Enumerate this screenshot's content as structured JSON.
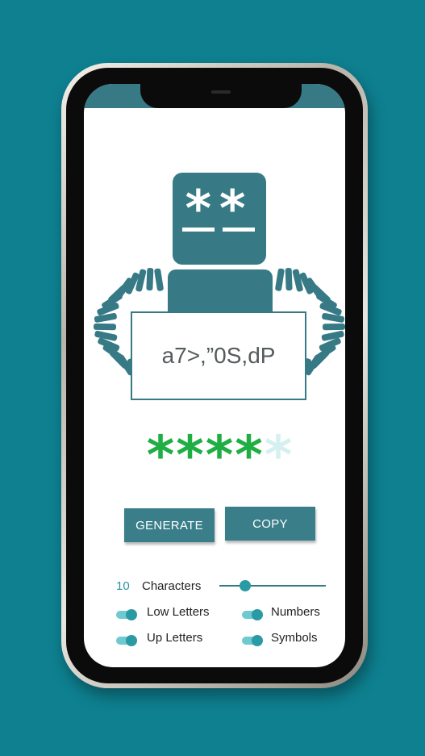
{
  "robot": {
    "eyes": "**",
    "sign_text": "a7>,”0S,dP"
  },
  "strength": {
    "symbol": "*",
    "level": 4,
    "max": 5,
    "color_on": "#1fae43",
    "color_off": "#d6f0f2"
  },
  "buttons": {
    "generate_label": "GENERATE",
    "copy_label": "COPY"
  },
  "length": {
    "value": "10",
    "label": "Characters",
    "min": 4,
    "max": 32
  },
  "options": {
    "low_letters": {
      "label": "Low Letters",
      "enabled": true
    },
    "numbers": {
      "label": "Numbers",
      "enabled": true
    },
    "up_letters": {
      "label": "Up Letters",
      "enabled": true
    },
    "symbols": {
      "label": "Symbols",
      "enabled": true
    }
  },
  "colors": {
    "background": "#0e8090",
    "accent": "#377a86"
  }
}
